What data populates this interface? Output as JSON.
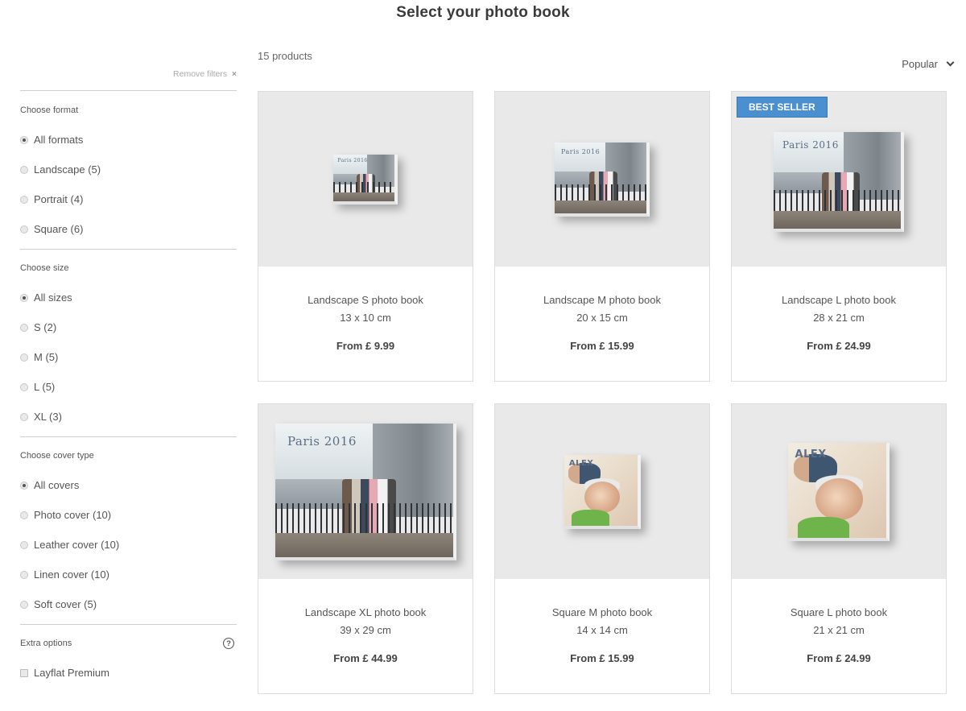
{
  "page_title": "Select your photo book",
  "remove_filters": "Remove filters",
  "remove_filters_icon": "×",
  "help_icon": "?",
  "filters": {
    "format": {
      "title": "Choose format",
      "options": [
        "All formats",
        "Landscape (5)",
        "Portrait (4)",
        "Square (6)"
      ],
      "selected": 0
    },
    "size": {
      "title": "Choose size",
      "options": [
        "All sizes",
        "S (2)",
        "M (5)",
        "L (5)",
        "XL (3)"
      ],
      "selected": 0
    },
    "cover": {
      "title": "Choose cover type",
      "options": [
        "All covers",
        "Photo cover (10)",
        "Leather cover (10)",
        "Linen cover (10)",
        "Soft cover (5)"
      ],
      "selected": 0
    },
    "extra": {
      "title": "Extra options",
      "checkbox_label": "Layflat Premium",
      "checked": false
    }
  },
  "results": {
    "count": "15 products",
    "sort": "Popular"
  },
  "products": [
    {
      "name": "Landscape S photo book",
      "dims": "13 x 10 cm",
      "price": "From £ 9.99",
      "cover_text": "Paris 2016",
      "badge": ""
    },
    {
      "name": "Landscape M photo book",
      "dims": "20 x 15 cm",
      "price": "From £ 15.99",
      "cover_text": "Paris 2016",
      "badge": ""
    },
    {
      "name": "Landscape L photo book",
      "dims": "28 x 21 cm",
      "price": "From £ 24.99",
      "cover_text": "Paris 2016",
      "badge": "BEST SELLER"
    },
    {
      "name": "Landscape XL photo book",
      "dims": "39 x 29 cm",
      "price": "From £ 44.99",
      "cover_text": "Paris 2016",
      "badge": ""
    },
    {
      "name": "Square M photo book",
      "dims": "14 x 14 cm",
      "price": "From £ 15.99",
      "cover_text": "ALEX",
      "badge": ""
    },
    {
      "name": "Square L photo book",
      "dims": "21 x 21 cm",
      "price": "From £ 24.99",
      "cover_text": "ALEX",
      "badge": ""
    }
  ],
  "colors": {
    "badge": "#4a8fcf",
    "image_bg": "#e9e9e9",
    "border": "#dcdcdc"
  }
}
